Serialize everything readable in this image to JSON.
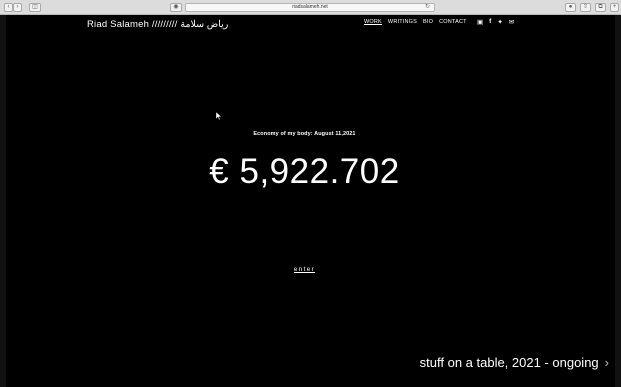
{
  "browser": {
    "url": "riadsalameh.net"
  },
  "site": {
    "brand": "Riad Salameh ///////// رياض سلامة"
  },
  "nav": {
    "items": [
      "WORK",
      "WRITINGS",
      "BIO",
      "CONTACT"
    ]
  },
  "social": [
    "instagram-icon",
    "facebook-icon",
    "twitter-icon",
    "mail-icon"
  ],
  "hero": {
    "subtitle": "Economy of my body: August 11,2021",
    "amount": "€ 5,922.702",
    "enter_label": "enter"
  },
  "footer": {
    "project_label": "stuff on a table, 2021 - ongoing"
  },
  "colors": {
    "background": "#000000",
    "text": "#ffffff"
  }
}
